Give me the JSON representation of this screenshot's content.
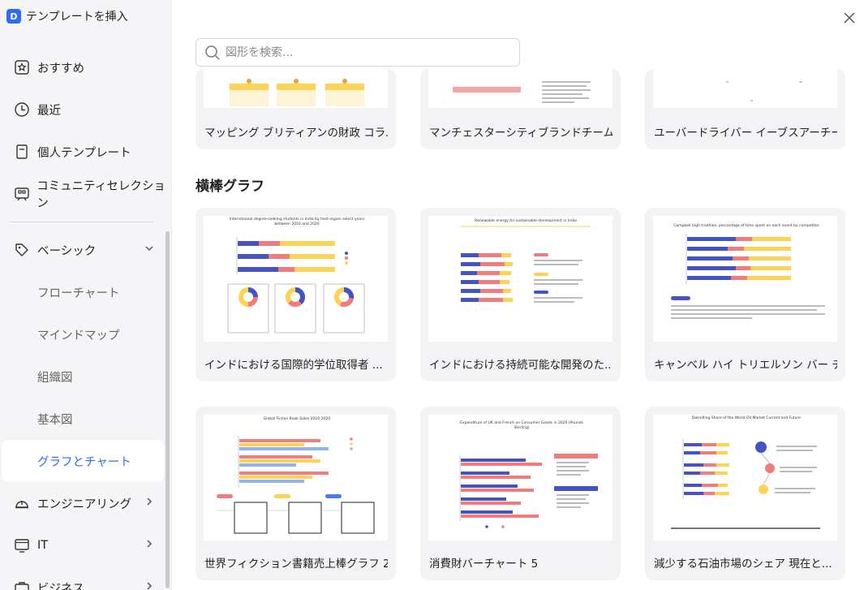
{
  "app": {
    "title": "テンプレートを挿入",
    "logo": "D"
  },
  "search": {
    "placeholder": "図形を検索..."
  },
  "sidebar": {
    "items": [
      {
        "label": "おすすめ",
        "icon": "star-icon"
      },
      {
        "label": "最近",
        "icon": "clock-icon"
      },
      {
        "label": "個人テンプレート",
        "icon": "document-icon"
      },
      {
        "label": "コミュニティセレクション",
        "icon": "community-icon"
      }
    ],
    "basic": {
      "label": "ベーシック",
      "icon": "tag-icon"
    },
    "sub_items": [
      {
        "label": "フローチャート",
        "active": false
      },
      {
        "label": "マインドマップ",
        "active": false
      },
      {
        "label": "組織図",
        "active": false
      },
      {
        "label": "基本図",
        "active": false
      },
      {
        "label": "グラフとチャート",
        "active": true
      }
    ],
    "bottom_items": [
      {
        "label": "エンジニアリング",
        "icon": "helmet-icon"
      },
      {
        "label": "IT",
        "icon": "monitor-icon"
      },
      {
        "label": "ビジネス",
        "icon": "briefcase-icon"
      }
    ]
  },
  "top_cards": [
    {
      "title": "マッピング ブリティアンの財政 コラム ..."
    },
    {
      "title": "マンチェスターシティブランドチームバリュ..."
    },
    {
      "title": "ユーバードライバー イーブスアーチーパー ..."
    }
  ],
  "section": {
    "title": "横棒グラフ"
  },
  "cards": [
    {
      "title": "インドにおける国際的学位取得者 ...",
      "thumb_heading": "International degree-seeking students in India by host-region select years between 2010 and 2020"
    },
    {
      "title": "インドにおける持続可能な開発のた...",
      "thumb_heading": "Renewable energy for sustainable development in India"
    },
    {
      "title": "キャンベル ハイ トリエルソン バー チ...",
      "thumb_heading": "Campbell high triathlon, percentage of time spent on each event by competitor"
    },
    {
      "title": "世界フィクション書籍売上棒グラフ 2",
      "thumb_heading": "Global Fiction Book Sales 2016-2020"
    },
    {
      "title": "消費財バーチャート 5",
      "thumb_heading": "Expenditure of UK and French on Consumer Goods in 2020 (Pounds Sterling)"
    },
    {
      "title": "減少する石油市場のシェア 現在と...",
      "thumb_heading": "Dwindling Share of the World Oil Market Current and Future"
    }
  ],
  "colors": {
    "accent": "#2f6bf5",
    "bar_blue": "#4454c3",
    "bar_red": "#f27b7b",
    "bar_yellow": "#fcd257",
    "bar_light": "#8fb5f0"
  }
}
